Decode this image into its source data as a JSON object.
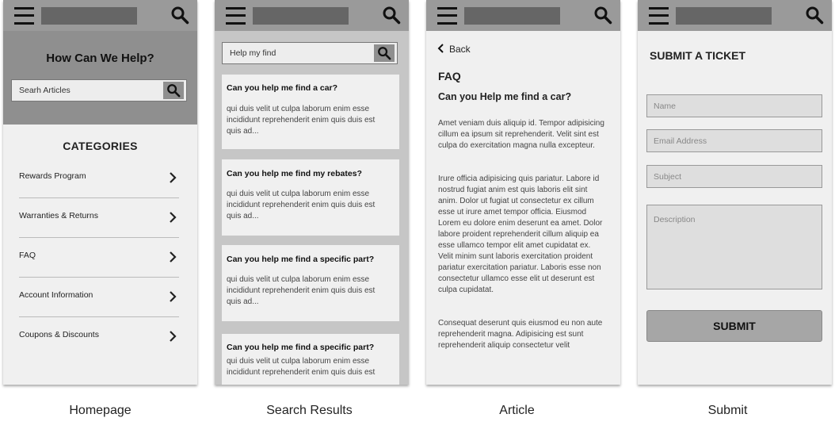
{
  "homepage": {
    "caption": "Homepage",
    "hero_title": "How Can We Help?",
    "search_placeholder": "Searh Articles",
    "categories_title": "CATEGORIES",
    "categories": [
      "Rewards Program",
      "Warranties & Returns",
      "FAQ",
      "Account Information",
      "Coupons & Discounts"
    ]
  },
  "search_results": {
    "caption": "Search Results",
    "query": "Help my find",
    "results": [
      {
        "question": "Can you help me find a car?",
        "excerpt": "qui duis velit ut culpa laborum enim esse incididunt reprehenderit enim quis duis est quis ad..."
      },
      {
        "question": "Can you help me find my rebates?",
        "excerpt": "qui duis velit ut culpa laborum enim esse incididunt reprehenderit enim quis duis est quis ad..."
      },
      {
        "question": "Can you help me find a specific part?",
        "excerpt": "qui duis velit ut culpa laborum enim esse incididunt reprehenderit enim quis duis est quis ad..."
      },
      {
        "question": "Can you help me find a specific part?",
        "excerpt": "qui duis velit ut culpa laborum enim esse incididunt reprehenderit enim quis duis est"
      }
    ]
  },
  "article": {
    "caption": "Article",
    "back_label": "Back",
    "section": "FAQ",
    "question": "Can you Help me find a car?",
    "paragraphs": [
      "Amet veniam duis aliquip id. Tempor adipisicing cillum ea ipsum sit reprehenderit. Velit sint est culpa do exercitation magna nulla excepteur.",
      "Irure officia adipisicing quis pariatur. Labore id nostrud fugiat anim est quis laboris elit sint anim. Dolor ut fugiat ut consectetur ex cillum esse ut irure amet tempor officia. Eiusmod Lorem eu dolore enim deserunt ea amet. Dolor labore proident reprehenderit cillum aliquip ea esse ullamco tempor elit amet cupidatat ex. Velit minim sunt laboris exercitation proident pariatur exercitation pariatur. Laboris esse non consectetur ullamco esse elit ut deserunt est culpa cupidatat.",
      "Consequat deserunt quis eiusmod eu non aute reprehenderit magna. Adipisicing est sunt reprehenderit aliquip consectetur velit"
    ]
  },
  "submit": {
    "caption": "Submit",
    "title": "SUBMIT A TICKET",
    "name_placeholder": "Name",
    "email_placeholder": "Email Address",
    "subject_placeholder": "Subject",
    "description_placeholder": "Description",
    "button_label": "SUBMIT"
  },
  "icons": {
    "menu": "hamburger-menu-icon",
    "search": "magnifier-search-icon",
    "chevron": "chevron-right-icon",
    "back": "chevron-left-icon"
  },
  "colors": {
    "topbar": "#9a9a9a",
    "title_placeholder": "#666666",
    "screen_bg": "#f0f0f0",
    "results_bg": "#c6c6c6"
  }
}
